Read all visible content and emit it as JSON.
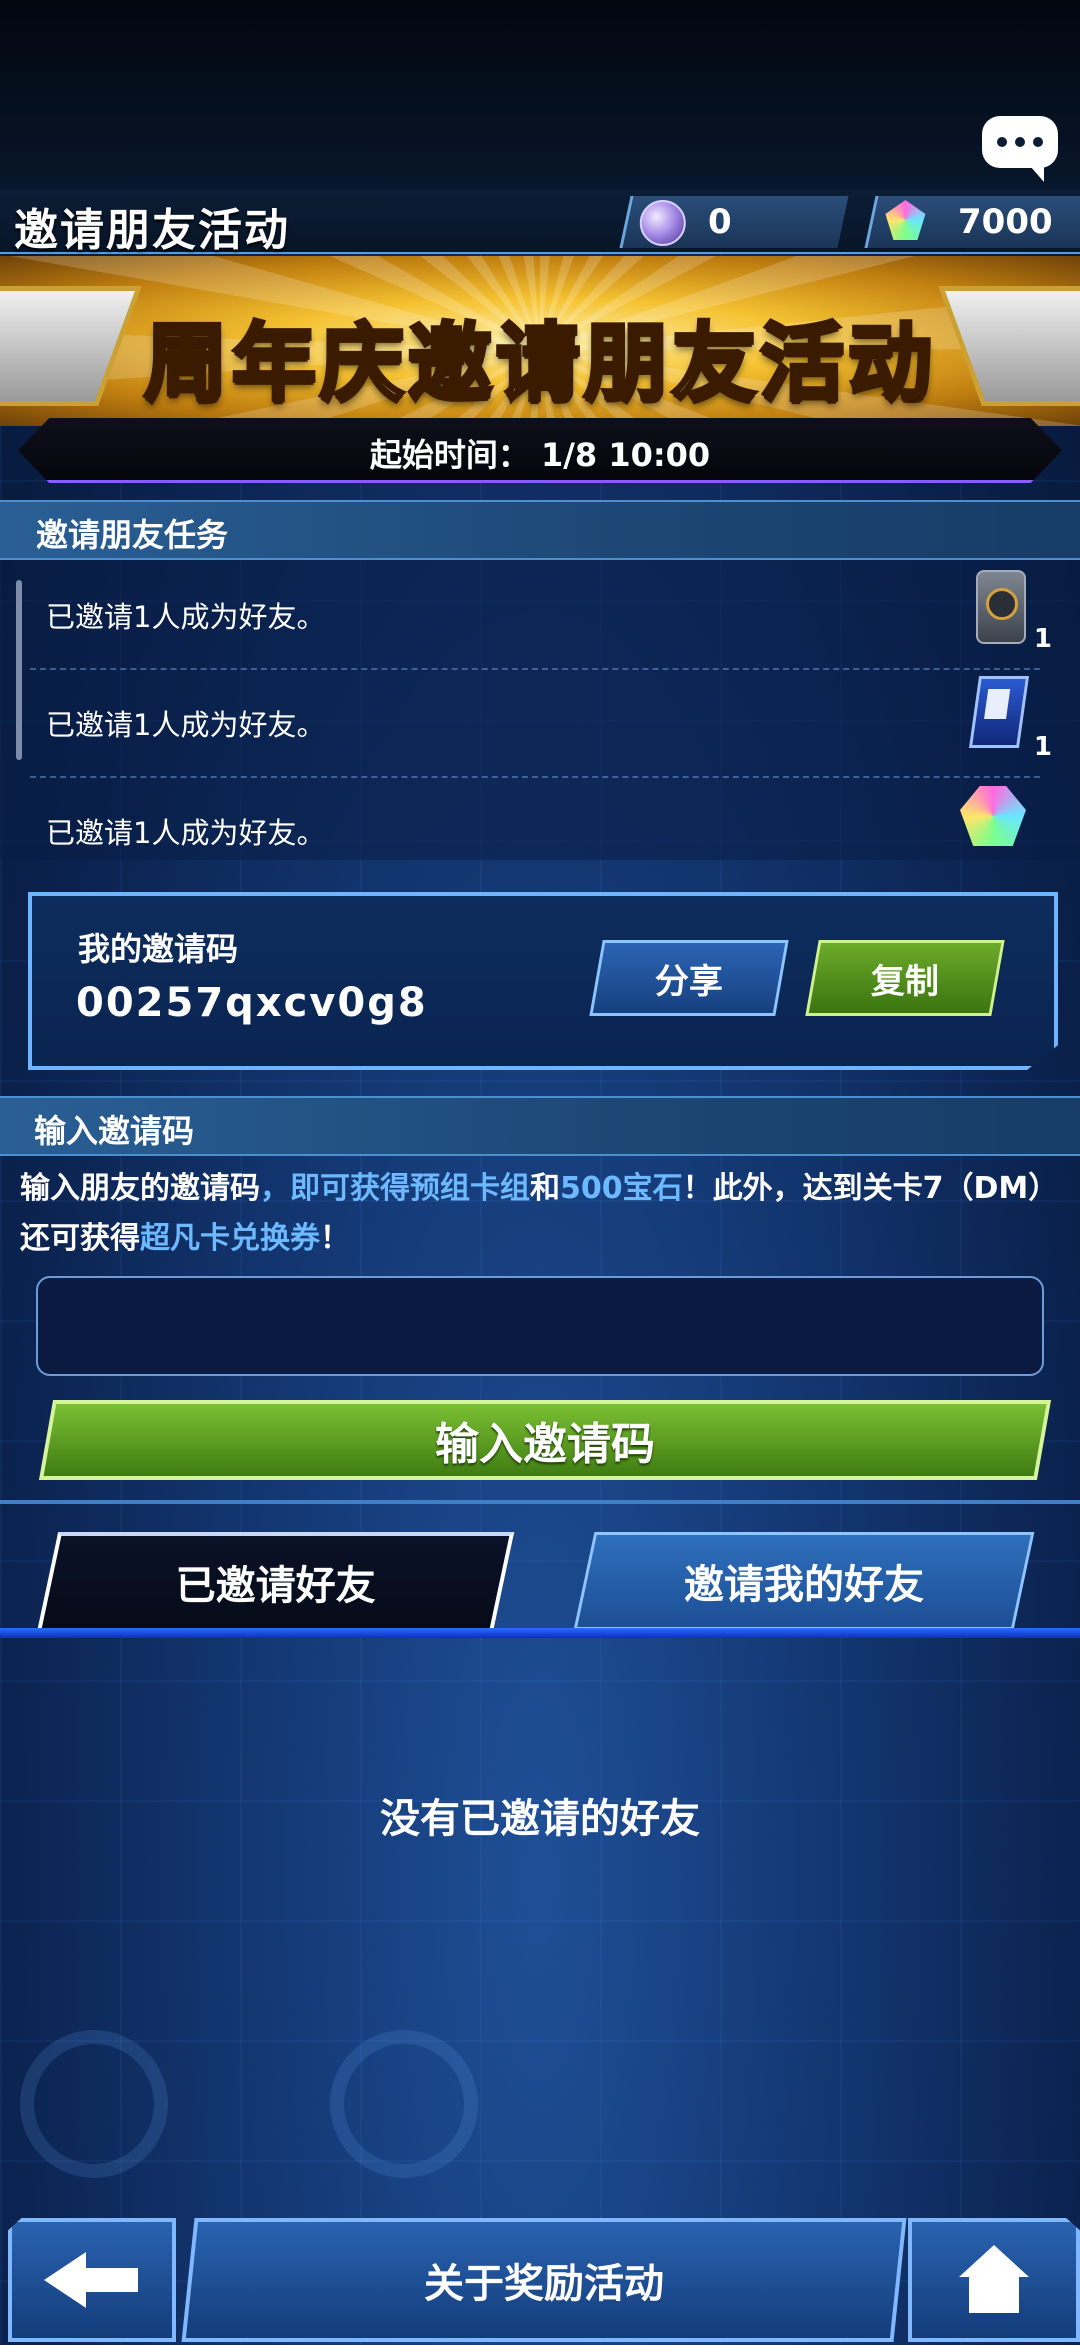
{
  "header": {
    "title": "邀请朋友活动",
    "currency_orb_value": "0",
    "currency_gem_value": "7000"
  },
  "banner": {
    "title": "周年庆邀请朋友活动",
    "start_time": "起始时间： 1/8 10:00"
  },
  "tasks": {
    "section_title": "邀请朋友任务",
    "items": [
      {
        "text": "已邀请1人成为好友。",
        "reward_icon": "card-tin-icon",
        "qty": "1"
      },
      {
        "text": "已邀请1人成为好友。",
        "reward_icon": "card-ticket-icon",
        "qty": "1"
      },
      {
        "text": "已邀请1人成为好友。",
        "reward_icon": "gem-icon",
        "qty": ""
      }
    ]
  },
  "my_code": {
    "label": "我的邀请码",
    "value": "00257qxcv0g8",
    "share_label": "分享",
    "copy_label": "复制"
  },
  "enter_code": {
    "section_title": "输入邀请码",
    "desc_part1": "输入朋友的邀请码",
    "desc_part2": "，即可获得预组卡组",
    "desc_part3": "和",
    "desc_part4": "500宝石",
    "desc_part5": "！此外，达到关卡7（DM）还可获得",
    "desc_part6": "超凡卡兑换券",
    "desc_part7": "！",
    "input_value": "",
    "submit_label": "输入邀请码"
  },
  "tabs": {
    "invited": "已邀请好友",
    "invited_me": "邀请我的好友",
    "active": "invited"
  },
  "list": {
    "empty_text": "没有已邀请的好友"
  },
  "footer": {
    "about_label": "关于奖励活动"
  },
  "colors": {
    "highlight": "#6db9ff",
    "green_button": "#5a9a22",
    "blue_button": "#1f4f94"
  }
}
